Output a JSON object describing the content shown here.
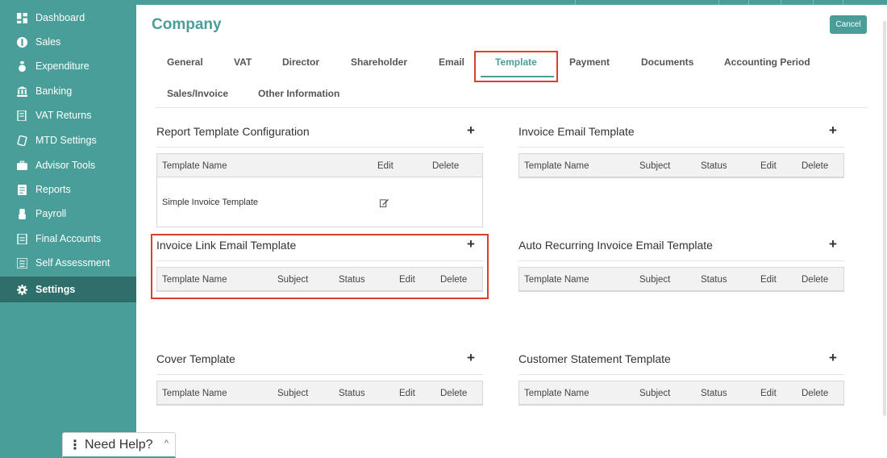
{
  "sidebar": {
    "items": [
      {
        "label": "Dashboard",
        "icon": "dashboard-icon"
      },
      {
        "label": "Sales",
        "icon": "sales-icon"
      },
      {
        "label": "Expenditure",
        "icon": "expenditure-icon"
      },
      {
        "label": "Banking",
        "icon": "bank-icon"
      },
      {
        "label": "VAT Returns",
        "icon": "vat-returns-icon"
      },
      {
        "label": "MTD Settings",
        "icon": "mtd-settings-icon"
      },
      {
        "label": "Advisor Tools",
        "icon": "briefcase-icon"
      },
      {
        "label": "Reports",
        "icon": "reports-icon"
      },
      {
        "label": "Payroll",
        "icon": "payroll-icon"
      },
      {
        "label": "Final Accounts",
        "icon": "final-accounts-icon"
      },
      {
        "label": "Self Assessment",
        "icon": "self-assessment-icon"
      },
      {
        "label": "Settings",
        "icon": "gear-icon",
        "active": true
      }
    ]
  },
  "header": {
    "title": "Company",
    "cancel_label": "Cancel"
  },
  "tabs": [
    {
      "label": "General"
    },
    {
      "label": "VAT"
    },
    {
      "label": "Director"
    },
    {
      "label": "Shareholder"
    },
    {
      "label": "Email"
    },
    {
      "label": "Template",
      "active": true
    },
    {
      "label": "Payment"
    },
    {
      "label": "Documents"
    },
    {
      "label": "Accounting Period"
    },
    {
      "label": "Sales/Invoice"
    },
    {
      "label": "Other Information"
    }
  ],
  "sections": {
    "report_template": {
      "title": "Report Template Configuration",
      "add_label": "+",
      "columns": [
        "Template Name",
        "Edit",
        "Delete"
      ],
      "rows": [
        {
          "template_name": "Simple Invoice Template"
        }
      ]
    },
    "invoice_email": {
      "title": "Invoice Email Template",
      "add_label": "+",
      "columns": [
        "Template Name",
        "Subject",
        "Status",
        "Edit",
        "Delete"
      ]
    },
    "invoice_link_email": {
      "title": "Invoice Link Email Template",
      "add_label": "+",
      "columns": [
        "Template Name",
        "Subject",
        "Status",
        "Edit",
        "Delete"
      ]
    },
    "auto_recurring": {
      "title": "Auto Recurring Invoice Email Template",
      "add_label": "+",
      "columns": [
        "Template Name",
        "Subject",
        "Status",
        "Edit",
        "Delete"
      ]
    },
    "cover": {
      "title": "Cover Template",
      "add_label": "+",
      "columns": [
        "Template Name",
        "Subject",
        "Status",
        "Edit",
        "Delete"
      ]
    },
    "customer_statement": {
      "title": "Customer Statement Template",
      "add_label": "+",
      "columns": [
        "Template Name",
        "Subject",
        "Status",
        "Edit",
        "Delete"
      ]
    }
  },
  "help": {
    "label": "Need Help?",
    "dots": "⋮",
    "caret": "^"
  },
  "colors": {
    "brand": "#4a9e9a",
    "brand_dark": "#2e6f6c",
    "highlight": "#d9412e"
  }
}
